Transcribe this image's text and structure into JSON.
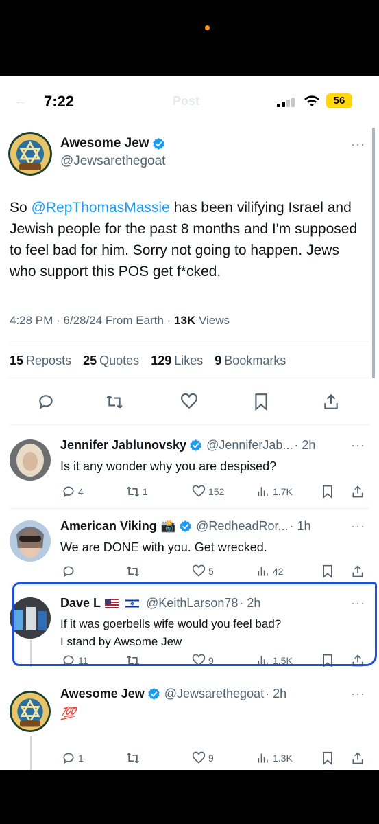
{
  "status_bar": {
    "time": "7:22",
    "faded_title": "Post",
    "battery": "56",
    "battery_color": "#ffd60a",
    "accent": "#ff9500"
  },
  "main_tweet": {
    "display_name": "Awesome Jew",
    "handle": "@Jewsarethegoat",
    "avatar_text_top": "AWESOME",
    "avatar_text_bottom": "JEW",
    "text_before": "So ",
    "mention": "@RepThomasMassie",
    "text_after": " has been vilifying Israel and Jewish people for the past 8 months and I'm supposed to feel bad for him. Sorry not going to happen. Jews who support this POS get f*cked.",
    "time": "4:28 PM",
    "date": "6/28/24",
    "source": "From Earth",
    "views_count": "13K",
    "views_label": "Views",
    "stats": [
      {
        "count": "15",
        "label": "Reposts"
      },
      {
        "count": "25",
        "label": "Quotes"
      },
      {
        "count": "129",
        "label": "Likes"
      },
      {
        "count": "9",
        "label": "Bookmarks"
      }
    ]
  },
  "replies": [
    {
      "display_name": "Jennifer Jablunovsky",
      "handle": "@JenniferJab...",
      "time": "· 2h",
      "text": "Is it any wonder why you are despised?",
      "replies": "4",
      "reposts": "1",
      "likes": "152",
      "views": "1.7K"
    },
    {
      "display_name": "American Viking",
      "emoji": "📸",
      "handle": "@RedheadRor...",
      "time": "· 1h",
      "text": "We are DONE with you. Get wrecked.",
      "replies": "",
      "reposts": "",
      "likes": "5",
      "views": "42"
    },
    {
      "display_name": "Dave L",
      "handle": "@KeithLarson78",
      "time": "· 2h",
      "text_line1": "If it was goerbells wife would you feel bad?",
      "text_line2": "I stand by Awsome Jew",
      "replies": "11",
      "reposts": "",
      "likes": "9",
      "views": "1.5K"
    },
    {
      "display_name": "Awesome Jew",
      "handle": "@Jewsarethegoat",
      "time": "· 2h",
      "text": "💯",
      "replies": "1",
      "reposts": "",
      "likes": "9",
      "views": "1.3K"
    }
  ],
  "colors": {
    "accent_blue": "#1d9bf0",
    "highlight": "#1d4fd8",
    "muted": "#536471"
  }
}
